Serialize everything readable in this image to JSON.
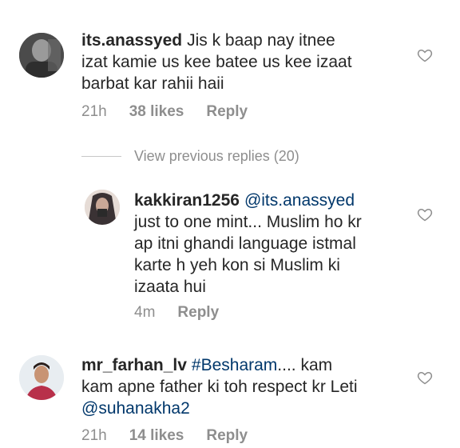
{
  "comments": [
    {
      "username": "its.anassyed",
      "text_lines": [
        "Jis k baap nay itnee",
        "izat kamie  us kee batee us kee izaat",
        "barbat kar rahii haii"
      ],
      "time": "21h",
      "likes": "38 likes",
      "reply_label": "Reply"
    },
    {
      "username": "kakkiran1256",
      "mention": "@its.anassyed",
      "text_lines": [
        "just to one mint... Muslim ho kr",
        "ap itni ghandi language  istmal",
        "karte h yeh kon si Muslim ki",
        "izaata hui"
      ],
      "time": "4m",
      "reply_label": "Reply"
    },
    {
      "username": "mr_farhan_lv",
      "hashtag": "#Besharam",
      "text_first_rest": ".... kam",
      "text_lines": [
        "kam apne father ki toh respect kr Leti"
      ],
      "mention2": "@suhanakha2",
      "time": "21h",
      "likes": "14 likes",
      "reply_label": "Reply"
    }
  ],
  "view_previous": "View previous replies (20)",
  "icons": {
    "heart": "heart-icon"
  },
  "colors": {
    "text": "#262626",
    "muted": "#8e8e8e",
    "link": "#00376b"
  }
}
